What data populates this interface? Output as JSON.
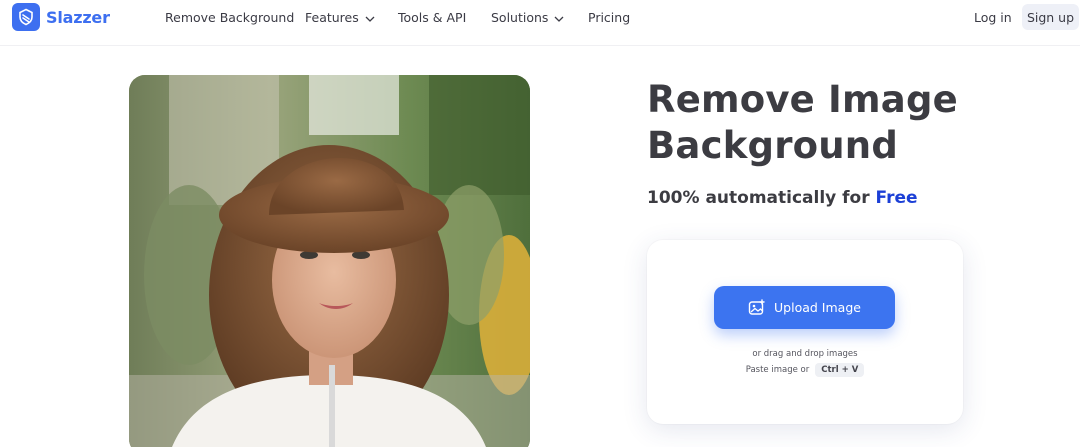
{
  "brand": {
    "name": "Slazzer",
    "accent": "#3d6ff0",
    "free_color": "#1b3fd6"
  },
  "nav": {
    "remove_background": "Remove Background",
    "features": "Features",
    "tools_api": "Tools & API",
    "solutions": "Solutions",
    "pricing": "Pricing",
    "login": "Log in",
    "signup": "Sign up"
  },
  "hero": {
    "title": "Remove Image Background",
    "subtitle_prefix": "100% automatically for",
    "subtitle_free": "Free",
    "upload_label": "Upload Image",
    "drag_hint": "or drag and drop images",
    "paste_hint": "Paste image or",
    "paste_shortcut": "Ctrl + V"
  },
  "icons": {
    "logo": "slazzer-logo-icon",
    "dropdown": "chevron-down-icon",
    "upload": "image-plus-icon"
  }
}
